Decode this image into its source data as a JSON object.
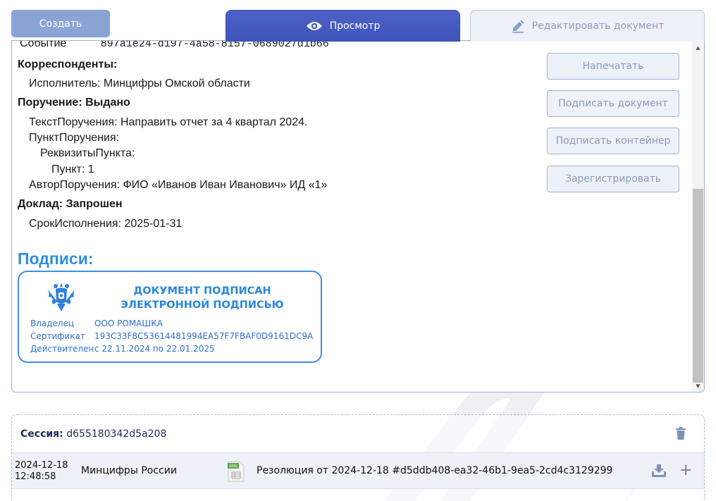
{
  "top_bar": {
    "create_label": "Создать",
    "view_tab_label": "Просмотр",
    "edit_tab_label": "Редактировать документ"
  },
  "document": {
    "event_label": "Событие",
    "event_id": "897a1e24-d197-4a58-8157-0689027d1b66",
    "correspondents_heading": "Корреспонденты:",
    "executor": "Исполнитель: Минцифры Омской области",
    "order_heading": "Поручение: Выдано",
    "order_text": "ТекстПоручения: Направить отчет за 4 квартал 2024.",
    "order_point": "ПунктПоручения:",
    "point_requisites": "РеквизитыПункта:",
    "point_number": "Пункт: 1",
    "order_author": "АвторПоручения: ФИО «Иванов Иван Иванович» ИД «1»",
    "report_heading": "Доклад: Запрошен",
    "deadline": "СрокИсполнения: 2025-01-31"
  },
  "signatures": {
    "heading": "Подписи:",
    "stamp": {
      "title_line1": "ДОКУМЕНТ ПОДПИСАН",
      "title_line2": "ЭЛЕКТРОННОЙ ПОДПИСЬЮ",
      "owner_label": "Владелец",
      "owner_value": "ООО РОМАШКА",
      "cert_label": "Сертификат",
      "cert_value": "193C33F8C53614481994EA57F7FBAF0D9161DC9A",
      "valid_label": "Действителен",
      "valid_value": "с 22.11.2024 по 22.01.2025"
    }
  },
  "actions": {
    "print": "Напечатать",
    "sign_document": "Подписать документ",
    "sign_container": "Подписать контейнер",
    "register": "Зарегистрировать"
  },
  "session": {
    "label": "Сессия:",
    "id": "d655180342d5a208",
    "row": {
      "date": "2024-12-18",
      "time": "12:48:58",
      "org": "Минцифры России",
      "file_badge": "XML",
      "name": "Резолюция от 2024-12-18 #d5ddb408-ea32-46b1-9ea5-2cd4c3129299"
    }
  },
  "icons": {
    "view": "eye-icon",
    "edit": "pencil-icon",
    "emblem": "coat-of-arms-icon",
    "delete": "trash-icon",
    "file": "xml-file-icon",
    "download": "download-icon",
    "add": "plus-icon"
  },
  "colors": {
    "accent": "#3f55bb",
    "signature_blue": "#2f8fe0",
    "button_fill": "#8aa4d6"
  }
}
